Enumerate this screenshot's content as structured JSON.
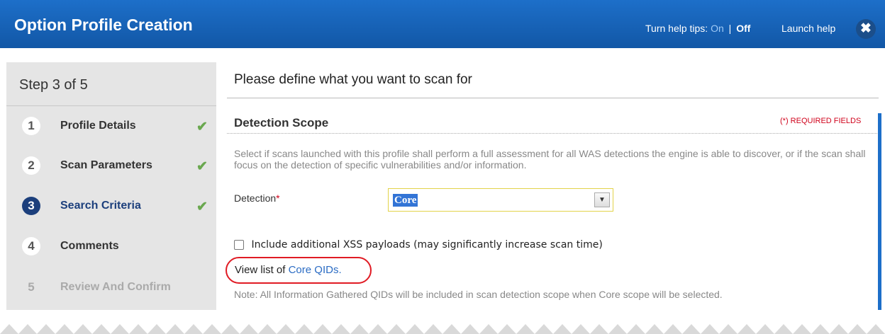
{
  "window": {
    "title": "Option Profile Creation",
    "help_tips_prefix": "Turn help tips:",
    "help_tips_on": "On",
    "help_tips_separator": "|",
    "help_tips_off": "Off",
    "launch_help": "Launch help",
    "close_icon": "✖"
  },
  "sidebar": {
    "step_header": "Step 3 of 5",
    "steps": [
      {
        "number": "1",
        "label": "Profile Details",
        "check": "✔",
        "state": "completed"
      },
      {
        "number": "2",
        "label": "Scan Parameters",
        "check": "✔",
        "state": "completed"
      },
      {
        "number": "3",
        "label": "Search Criteria",
        "check": "✔",
        "state": "active"
      },
      {
        "number": "4",
        "label": "Comments",
        "state": "pending"
      },
      {
        "number": "5",
        "label": "Review And Confirm",
        "state": "disabled"
      }
    ]
  },
  "main": {
    "heading": "Please define what you want to scan for",
    "section_title": "Detection Scope",
    "required_fields": "(*) REQUIRED FIELDS",
    "description": "Select if scans launched with this profile shall perform a full assessment for all WAS detections the engine is able to discover, or if the scan shall focus on the detection of specific vulnerabilities and/or information.",
    "detection_label": "Detection",
    "required_marker": "*",
    "detection_value": "Core",
    "xss_label": "Include additional XSS payloads (may significantly increase scan time)",
    "qid_prefix": "View list of ",
    "qid_link": "Core QIDs.",
    "note": "Note: All Information Gathered QIDs will be included in scan detection scope when Core scope will be selected."
  },
  "colors": {
    "title_bar": "#1d6fc9",
    "active_step": "#1c3f7c",
    "check": "#6aa84f",
    "required": "#d0021b",
    "link": "#2b6cc4",
    "highlight_outline": "#e01b24"
  },
  "icons": {
    "close": "close-icon",
    "check": "check-icon",
    "dropdown": "chevron-down-icon"
  }
}
